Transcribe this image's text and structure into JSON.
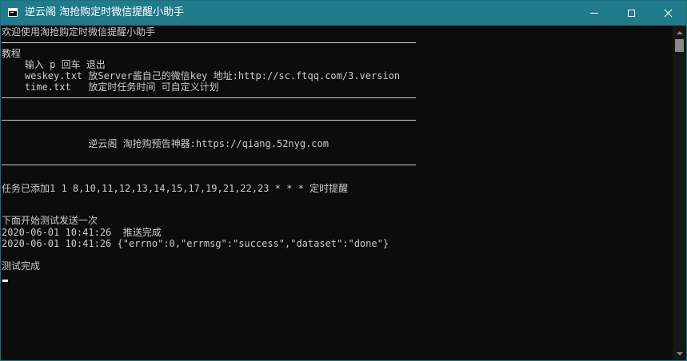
{
  "window": {
    "title": "逆云阁 淘抢购定时微信提醒小助手",
    "icon": "console-window-icon",
    "title_bar_color": "#1f7a8c",
    "controls": {
      "minimize": "minimize-icon",
      "maximize": "maximize-icon",
      "close": "close-icon"
    }
  },
  "console": {
    "background": "#0c0c0c",
    "foreground": "#cccccc",
    "lines": [
      "欢迎使用淘抢购定时微信提醒小助手",
      "教程",
      "    输入 p 回车 退出",
      "    weskey.txt 放Server酱自己的微信key 地址:http://sc.ftqq.com/3.version",
      "    time.txt   放定时任务时间 可自定义计划",
      "               逆云阁 淘抢购预告神器:https://qiang.52nyg.com",
      "任务已添加1 1 8,10,11,12,13,14,15,17,19,21,22,23 * * * 定时提醒",
      "下面开始测试发送一次",
      "2020-06-01 10:41:26  推送完成",
      "2020-06-01 10:41:26 {\"errno\":0,\"errmsg\":\"success\",\"dataset\":\"done\"}",
      "测试完成"
    ]
  }
}
